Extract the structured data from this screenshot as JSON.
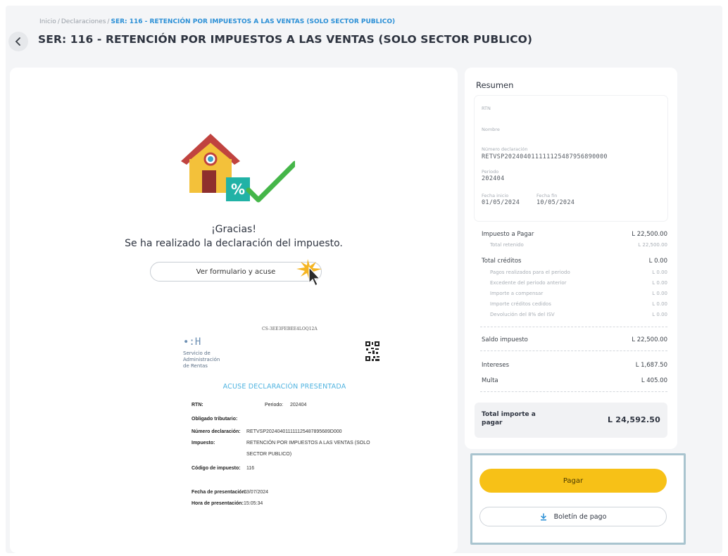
{
  "breadcrumb": {
    "home": "Inicio",
    "section": "Declaraciones",
    "current": "SER: 116 - RETENCIÓN POR IMPUESTOS A LAS VENTAS (SOLO SECTOR PUBLICO)",
    "separator": "/"
  },
  "header": {
    "title": "SER: 116 - RETENCIÓN POR IMPUESTOS A LAS VENTAS (SOLO SECTOR PUBLICO)",
    "back_icon": "chevron-left-icon"
  },
  "confirmation": {
    "title": "¡Gracias!",
    "subtitle": "Se ha realizado la declaración del impuesto.",
    "view_button": "Ver formulario y acuse",
    "illustration_badge": "%"
  },
  "receipt": {
    "top_code": "CS-3EE3FEBEE4LOQ12A",
    "logo_mark": "∙:H",
    "logo_lines": [
      "Servicio de",
      "Administración",
      "de Rentas"
    ],
    "title": "ACUSE DECLARACIÓN PRESENTADA",
    "rtn_label": "RTN:",
    "periodo_label": "Periodo:",
    "periodo_value": "202404",
    "obligado_label": "Obligado tributario:",
    "numero_label": "Número declaración:",
    "numero_value": "RETVSP202404011111125487895689D000",
    "impuesto_label": "Impuesto:",
    "impuesto_value_1": "RETENCIÓN POR IMPUESTOS A LAS VENTAS (SOLO",
    "impuesto_value_2": "SECTOR PUBLICO)",
    "codigo_label": "Código de impuesto:",
    "codigo_value": "116",
    "fecha_label": "Fecha de presentación:",
    "fecha_value": "03/07/2024",
    "hora_label": "Hora de presentación:",
    "hora_value": "15:05:34"
  },
  "summary": {
    "title": "Resumen",
    "rtn_label": "RTN",
    "nombre_label": "Nombre",
    "numero_label": "Número declaración",
    "numero_value": "RETVSP202404011111125487956890000",
    "periodo_label": "Periodo",
    "periodo_value": "202404",
    "fecha_inicio_label": "Fecha inicio",
    "fecha_inicio_value": "01/05/2024",
    "fecha_fin_label": "Fecha fin",
    "fecha_fin_value": "10/05/2024",
    "impuesto_pagar_label": "Impuesto a Pagar",
    "impuesto_pagar_value": "L 22,500.00",
    "total_retenido_label": "Total retenido",
    "total_retenido_value": "L 22,500.00",
    "total_creditos_label": "Total créditos",
    "total_creditos_value": "L 0.00",
    "credits": [
      {
        "label": "Pagos realizados para el periodo",
        "value": "L 0.00"
      },
      {
        "label": "Excedente del periodo anterior",
        "value": "L 0.00"
      },
      {
        "label": "Importe a compensar",
        "value": "L 0.00"
      },
      {
        "label": "Importe créditos cedidos",
        "value": "L 0.00"
      },
      {
        "label": "Devolución del 8% del ISV",
        "value": "L 0.00"
      }
    ],
    "saldo_label": "Saldo impuesto",
    "saldo_value": "L 22,500.00",
    "intereses_label": "Intereses",
    "intereses_value": "L 1,687.50",
    "multa_label": "Multa",
    "multa_value": "L 405.00",
    "total_label": "Total importe a pagar",
    "total_value": "L 24,592.50"
  },
  "actions": {
    "pay_label": "Pagar",
    "slip_label": "Boletín de pago",
    "slip_icon": "download-icon"
  },
  "colors": {
    "accent_blue": "#2a8fd6",
    "pay_yellow": "#f7c117",
    "receipt_title": "#4fb3e0",
    "frame_highlight": "#a9c4cf"
  }
}
